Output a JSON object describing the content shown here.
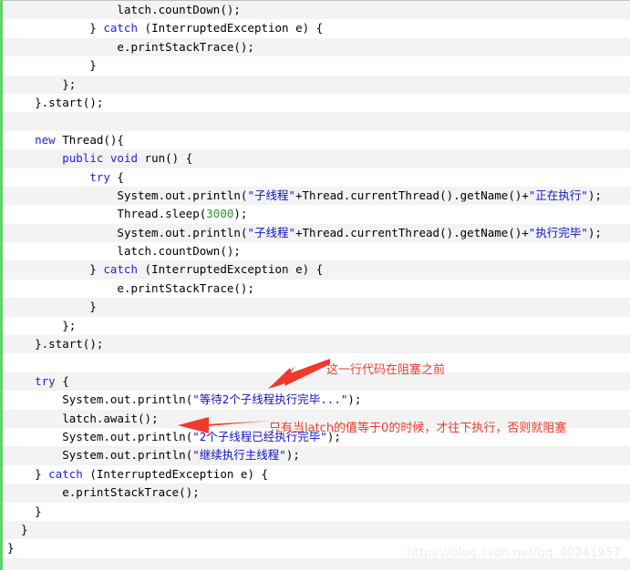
{
  "code": {
    "language": "java",
    "left_accent_color": "#65d16b",
    "stripe_color": "#f3f3f3",
    "lines": [
      {
        "indent": 0,
        "stripe": true,
        "text": "                latch.countDown();"
      },
      {
        "indent": 0,
        "stripe": false,
        "text": "            } catch (InterruptedException e) {"
      },
      {
        "indent": 0,
        "stripe": true,
        "text": "                e.printStackTrace();"
      },
      {
        "indent": 0,
        "stripe": false,
        "text": "            }"
      },
      {
        "indent": 0,
        "stripe": true,
        "text": "        };"
      },
      {
        "indent": 0,
        "stripe": false,
        "text": "    }.start();"
      },
      {
        "indent": 0,
        "stripe": true,
        "text": ""
      },
      {
        "indent": 0,
        "stripe": false,
        "text": "    new Thread(){"
      },
      {
        "indent": 0,
        "stripe": true,
        "text": "        public void run() {"
      },
      {
        "indent": 0,
        "stripe": false,
        "text": "            try {"
      },
      {
        "indent": 0,
        "stripe": true,
        "text": "                System.out.println(\"子线程\"+Thread.currentThread().getName()+\"正在执行\");"
      },
      {
        "indent": 0,
        "stripe": false,
        "text": "                Thread.sleep(3000);"
      },
      {
        "indent": 0,
        "stripe": true,
        "text": "                System.out.println(\"子线程\"+Thread.currentThread().getName()+\"执行完毕\");"
      },
      {
        "indent": 0,
        "stripe": false,
        "text": "                latch.countDown();"
      },
      {
        "indent": 0,
        "stripe": true,
        "text": "            } catch (InterruptedException e) {"
      },
      {
        "indent": 0,
        "stripe": false,
        "text": "                e.printStackTrace();"
      },
      {
        "indent": 0,
        "stripe": true,
        "text": "            }"
      },
      {
        "indent": 0,
        "stripe": false,
        "text": "        };"
      },
      {
        "indent": 0,
        "stripe": true,
        "text": "    }.start();"
      },
      {
        "indent": 0,
        "stripe": false,
        "text": ""
      },
      {
        "indent": 0,
        "stripe": true,
        "text": "    try {"
      },
      {
        "indent": 0,
        "stripe": false,
        "text": "        System.out.println(\"等待2个子线程执行完毕...\");"
      },
      {
        "indent": 0,
        "stripe": true,
        "text": "        latch.await();"
      },
      {
        "indent": 0,
        "stripe": false,
        "text": "        System.out.println(\"2个子线程已经执行完毕\");"
      },
      {
        "indent": 0,
        "stripe": true,
        "text": "        System.out.println(\"继续执行主线程\");"
      },
      {
        "indent": 0,
        "stripe": false,
        "text": "    } catch (InterruptedException e) {"
      },
      {
        "indent": 0,
        "stripe": true,
        "text": "        e.printStackTrace();"
      },
      {
        "indent": 0,
        "stripe": false,
        "text": "    }"
      },
      {
        "indent": 0,
        "stripe": true,
        "text": "  }"
      },
      {
        "indent": 0,
        "stripe": false,
        "text": "}"
      },
      {
        "indent": 0,
        "stripe": true,
        "text": ""
      }
    ]
  },
  "annotations": {
    "color": "#f0392b",
    "items": [
      {
        "id": "annotation-before-block",
        "text": "这一行代码在阻塞之前",
        "arrow": "diagonal-down-left"
      },
      {
        "id": "annotation-await-explanation",
        "text": "只有当latch的值等于0的时候，才往下执行，否则就阻塞",
        "arrow": "horizontal-left"
      }
    ]
  },
  "watermark": {
    "text": "https://blog.csdn.net/qq_40241957",
    "color": "#ececec"
  }
}
